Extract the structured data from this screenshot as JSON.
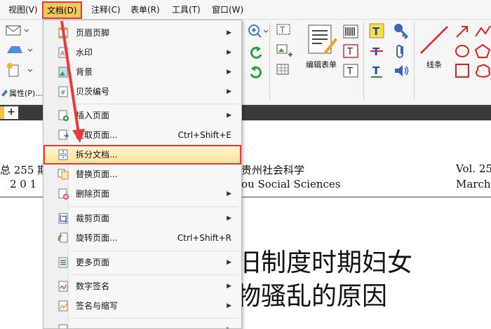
{
  "menubar": {
    "items": [
      "视图(V)",
      "文档(D)",
      "注释(C)",
      "表单(R)",
      "工具(T)",
      "窗口(W)"
    ],
    "active": "文档(D)"
  },
  "ribbon": {
    "properties_label": "属性(P)...",
    "edit_form_label": "编辑表单",
    "line_label": "线条"
  },
  "dropdown": {
    "items": [
      {
        "label": "页眉页脚",
        "shortcut": "",
        "submenu": true,
        "icon": "header-footer-icon"
      },
      {
        "label": "水印",
        "shortcut": "",
        "submenu": true,
        "icon": "watermark-icon"
      },
      {
        "label": "背景",
        "shortcut": "",
        "submenu": true,
        "icon": "background-icon"
      },
      {
        "label": "贝茨编号",
        "shortcut": "",
        "submenu": true,
        "icon": "bates-number-icon"
      },
      {
        "label": "插入页面",
        "shortcut": "",
        "submenu": true,
        "icon": "insert-page-icon"
      },
      {
        "label": "提取页面...",
        "shortcut": "Ctrl+Shift+E",
        "submenu": false,
        "icon": "extract-page-icon"
      },
      {
        "label": "拆分文档...",
        "shortcut": "",
        "submenu": false,
        "icon": "split-document-icon"
      },
      {
        "label": "替换页面...",
        "shortcut": "",
        "submenu": false,
        "icon": "replace-page-icon"
      },
      {
        "label": "删除页面",
        "shortcut": "",
        "submenu": true,
        "icon": "delete-page-icon"
      },
      {
        "label": "裁剪页面",
        "shortcut": "",
        "submenu": true,
        "icon": "crop-page-icon"
      },
      {
        "label": "旋转页面...",
        "shortcut": "Ctrl+Shift+R",
        "submenu": false,
        "icon": "rotate-page-icon"
      },
      {
        "label": "更多页面",
        "shortcut": "",
        "submenu": true,
        "icon": "more-pages-icon"
      },
      {
        "label": "数字签名",
        "shortcut": "",
        "submenu": true,
        "icon": "digital-signature-icon"
      },
      {
        "label": "签名与缩写",
        "shortcut": "",
        "submenu": true,
        "icon": "sign-initials-icon"
      },
      {
        "label": "",
        "shortcut": "",
        "submenu": true,
        "icon": "partial-item-icon"
      }
    ],
    "highlighted": "拆分文档..."
  },
  "document": {
    "header_left_1": "总 255 期",
    "header_left_2": "2 0 1",
    "header_center_1": "贵州社会科学",
    "header_center_2": "ou Social Sciences",
    "header_right_1": "Vol. 25",
    "header_right_2": "March.",
    "title_line_1": "旧制度时期妇女",
    "title_line_2": "物骚乱的原因"
  },
  "colors": {
    "highlight_border": "#e53b3b",
    "active_menu_bg": "#f3c95a",
    "tab_strip": "#3a3a3a"
  }
}
